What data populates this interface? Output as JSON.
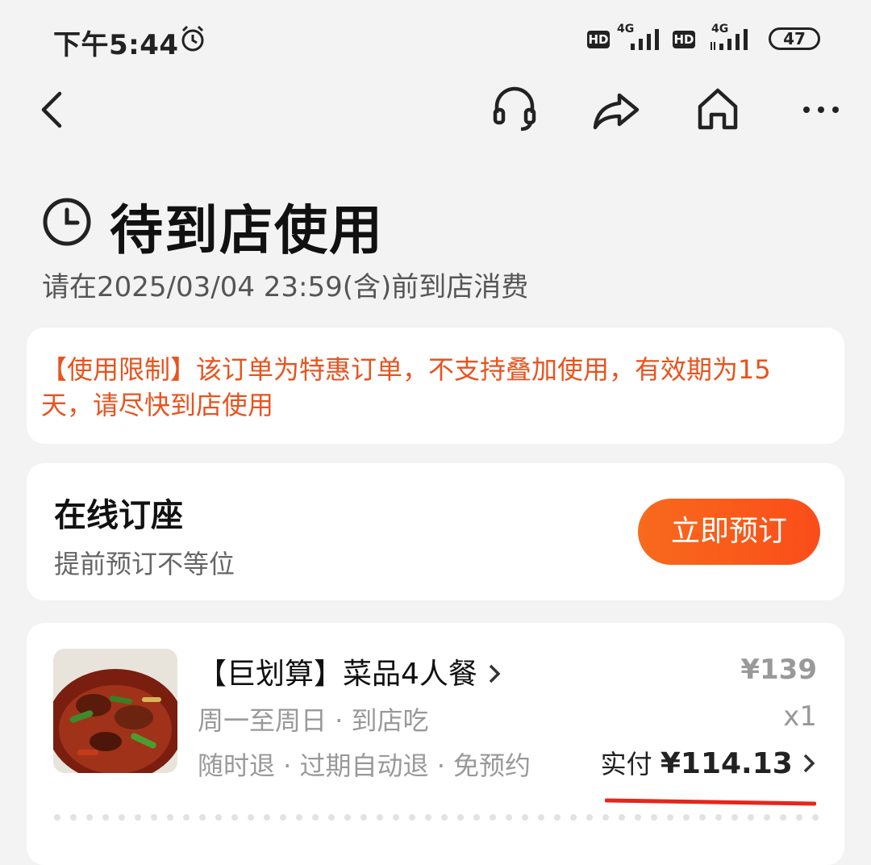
{
  "status_bar": {
    "time": "下午5:44",
    "net1": "4G",
    "net2": "4G",
    "hd1": "HD",
    "hd2": "HD",
    "battery": "47"
  },
  "nav": {
    "icons": [
      "back-icon",
      "headset-icon",
      "share-icon",
      "home-icon",
      "more-icon"
    ]
  },
  "header": {
    "title": "待到店使用",
    "subtitle": "请在2025/03/04 23:59(含)前到店消费"
  },
  "notice": {
    "text": "【使用限制】该订单为特惠订单，不支持叠加使用，有效期为15天，请尽快到店使用",
    "color": "#e8531e"
  },
  "booking": {
    "title": "在线订座",
    "subtitle": "提前预订不等位",
    "button": "立即预订",
    "accent": "#f86a1c"
  },
  "order": {
    "name": "【巨划算】菜品4人餐",
    "line1": "周一至周日 · 到店吃",
    "line2": "随时退 · 过期自动退 · 免预约",
    "price": "¥139",
    "qty": "x1",
    "paid_label": "实付",
    "paid_amount": "¥114.13"
  }
}
